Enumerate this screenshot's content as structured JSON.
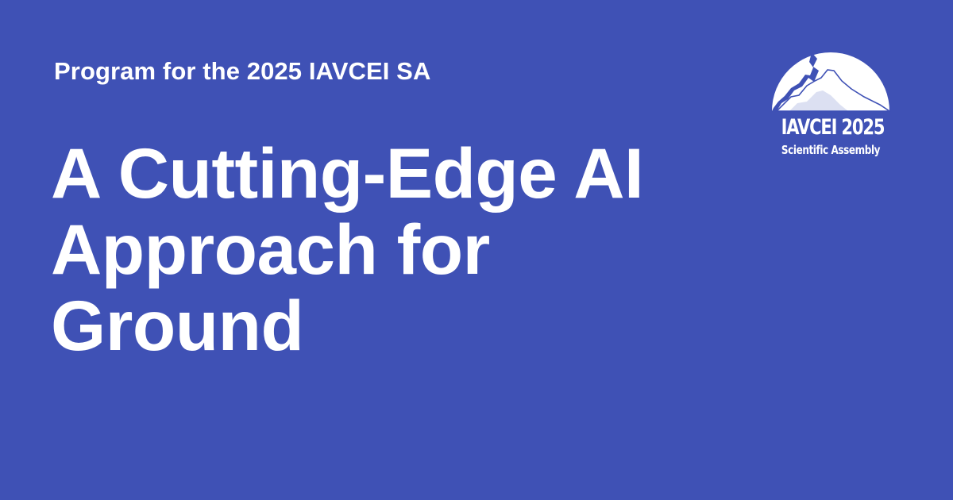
{
  "page": {
    "background_color": "#3f51b5",
    "text_color": "#ffffff"
  },
  "subtitle": "Program for the 2025 IAVCEI SA",
  "headline": {
    "lines": [
      "A Cutting-Edge AI",
      "Approach for",
      "Ground"
    ]
  },
  "logo": {
    "icon": "volcano-logo-icon",
    "line1": "IAVCEI 2025",
    "line2": "Scientific Assembly"
  }
}
